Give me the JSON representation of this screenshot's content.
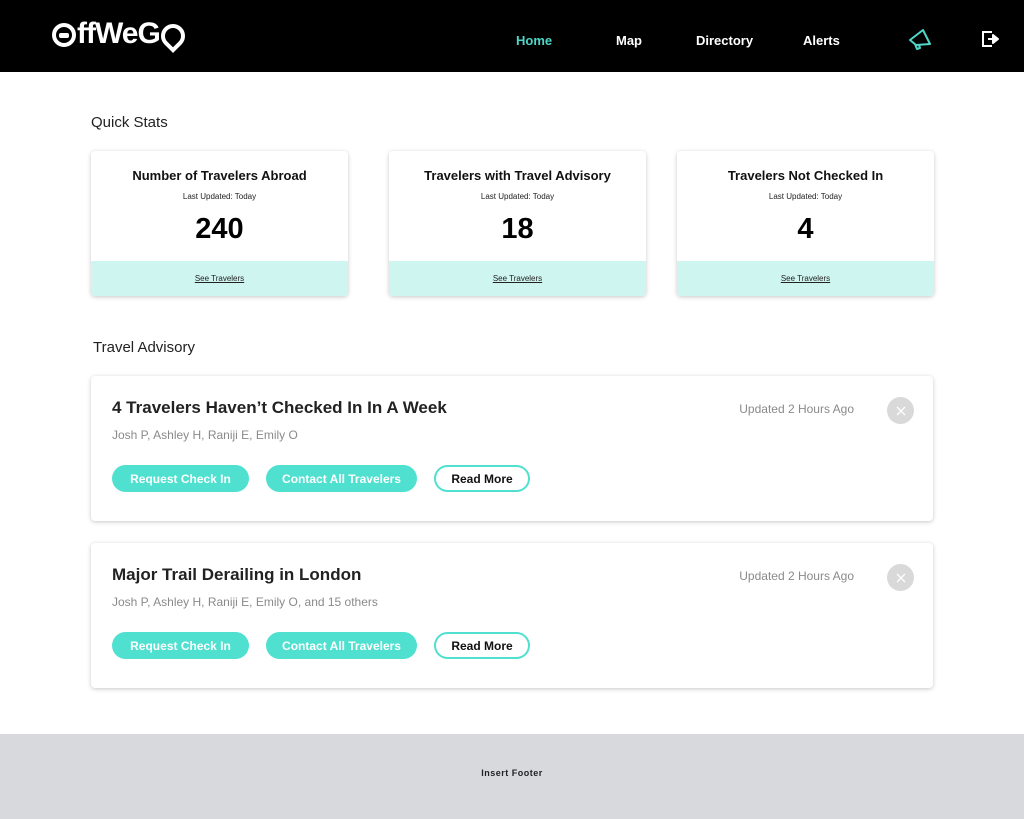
{
  "app": {
    "name": "OffWeGO"
  },
  "nav": {
    "links": [
      {
        "label": "Home",
        "active": true
      },
      {
        "label": "Map",
        "active": false
      },
      {
        "label": "Directory",
        "active": false
      },
      {
        "label": "Alerts",
        "active": false
      }
    ],
    "icons": [
      "megaphone-icon",
      "logout-icon"
    ],
    "accent_color": "#4fd6c7"
  },
  "quick_stats": {
    "title": "Quick Stats",
    "cards": [
      {
        "title": "Number of Travelers Abroad",
        "updated": "Last Updated: Today",
        "value": "240",
        "link": "See Travelers"
      },
      {
        "title": "Travelers with Travel Advisory",
        "updated": "Last Updated: Today",
        "value": "18",
        "link": "See Travelers"
      },
      {
        "title": "Travelers Not Checked In",
        "updated": "Last Updated: Today",
        "value": "4",
        "link": "See Travelers"
      }
    ]
  },
  "travel_advisory": {
    "title": "Travel Advisory",
    "items": [
      {
        "title": "4 Travelers Haven’t Checked In In A Week",
        "names": "Josh P, Ashley H, Raniji E, Emily O",
        "updated": "Updated 2 Hours Ago",
        "buttons": {
          "request": "Request Check In",
          "contact": "Contact All Travelers",
          "read_more": "Read More"
        }
      },
      {
        "title": "Major Trail Derailing in London",
        "names": "Josh P, Ashley H, Raniji E, Emily O, and 15 others",
        "updated": "Updated 2 Hours Ago",
        "buttons": {
          "request": "Request Check In",
          "contact": "Contact All Travelers",
          "read_more": "Read More"
        }
      }
    ]
  },
  "footer": {
    "text": "Insert Footer"
  },
  "colors": {
    "accent": "#4fe0cf",
    "card_footer": "#cff5f0",
    "footer_bg": "#d8d9dd",
    "nav_bg": "#000000"
  }
}
